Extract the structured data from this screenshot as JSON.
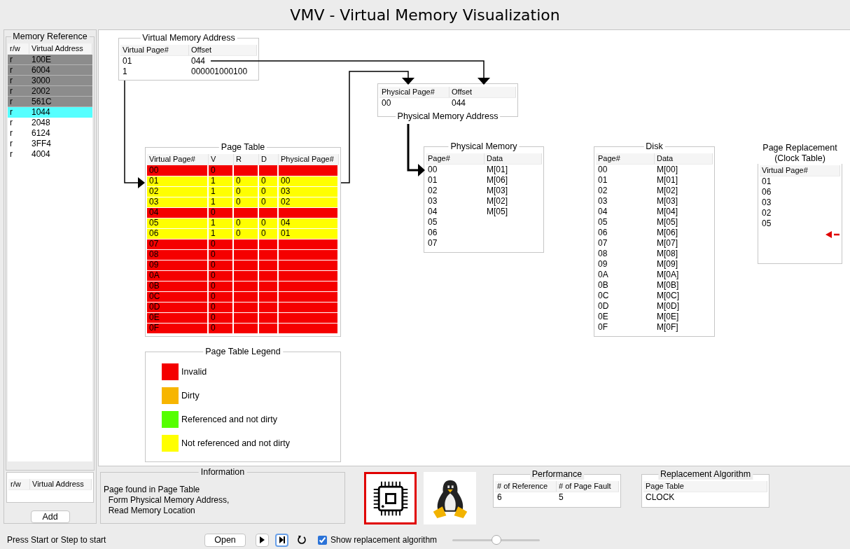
{
  "window": {
    "title": "VMV - Virtual Memory Visualization"
  },
  "memory_reference": {
    "title": "Memory Reference",
    "columns": [
      "r/w",
      "Virtual Address"
    ],
    "rows": [
      {
        "rw": "r",
        "address": "100E",
        "processed": true,
        "selected": false
      },
      {
        "rw": "r",
        "address": "6004",
        "processed": true,
        "selected": false
      },
      {
        "rw": "r",
        "address": "3000",
        "processed": true,
        "selected": false
      },
      {
        "rw": "r",
        "address": "2002",
        "processed": true,
        "selected": false
      },
      {
        "rw": "r",
        "address": "561C",
        "processed": true,
        "selected": false
      },
      {
        "rw": "r",
        "address": "1044",
        "processed": false,
        "selected": true
      },
      {
        "rw": "r",
        "address": "2048",
        "processed": false,
        "selected": false
      },
      {
        "rw": "r",
        "address": "6124",
        "processed": false,
        "selected": false
      },
      {
        "rw": "r",
        "address": "3FF4",
        "processed": false,
        "selected": false
      },
      {
        "rw": "r",
        "address": "4004",
        "processed": false,
        "selected": false
      }
    ],
    "new_reference": {
      "columns": [
        "r/w",
        "Virtual Address"
      ]
    },
    "add_button": "Add"
  },
  "virtual_address": {
    "title": "Virtual Memory Address",
    "columns": [
      "Virtual Page#",
      "Offset"
    ],
    "rows": [
      [
        "01",
        "044"
      ],
      [
        "1",
        "000001000100"
      ]
    ]
  },
  "physical_address": {
    "title": "Physical Memory Address",
    "columns": [
      "Physical Page#",
      "Offset"
    ],
    "rows": [
      [
        "00",
        "044"
      ]
    ]
  },
  "page_table": {
    "title": "Page Table",
    "columns": [
      "Virtual Page#",
      "V",
      "R",
      "D",
      "Physical Page#"
    ],
    "rows": [
      {
        "cells": [
          "00",
          "0"
        ],
        "color": "#f50000"
      },
      {
        "cells": [
          "01",
          "1",
          "0",
          "0",
          "00"
        ],
        "color": "#ffff00"
      },
      {
        "cells": [
          "02",
          "1",
          "0",
          "0",
          "03"
        ],
        "color": "#ffff00"
      },
      {
        "cells": [
          "03",
          "1",
          "0",
          "0",
          "02"
        ],
        "color": "#ffff00"
      },
      {
        "cells": [
          "04",
          "0"
        ],
        "color": "#f50000"
      },
      {
        "cells": [
          "05",
          "1",
          "0",
          "0",
          "04"
        ],
        "color": "#ffff00"
      },
      {
        "cells": [
          "06",
          "1",
          "0",
          "0",
          "01"
        ],
        "color": "#ffff00"
      },
      {
        "cells": [
          "07",
          "0"
        ],
        "color": "#f50000"
      },
      {
        "cells": [
          "08",
          "0"
        ],
        "color": "#f50000"
      },
      {
        "cells": [
          "09",
          "0"
        ],
        "color": "#f50000"
      },
      {
        "cells": [
          "0A",
          "0"
        ],
        "color": "#f50000"
      },
      {
        "cells": [
          "0B",
          "0"
        ],
        "color": "#f50000"
      },
      {
        "cells": [
          "0C",
          "0"
        ],
        "color": "#f50000"
      },
      {
        "cells": [
          "0D",
          "0"
        ],
        "color": "#f50000"
      },
      {
        "cells": [
          "0E",
          "0"
        ],
        "color": "#f50000"
      },
      {
        "cells": [
          "0F",
          "0"
        ],
        "color": "#f50000"
      }
    ]
  },
  "physical_memory": {
    "title": "Physical Memory",
    "columns": [
      "Page#",
      "Data"
    ],
    "rows": [
      [
        "00",
        "M[01]"
      ],
      [
        "01",
        "M[06]"
      ],
      [
        "02",
        "M[03]"
      ],
      [
        "03",
        "M[02]"
      ],
      [
        "04",
        "M[05]"
      ],
      [
        "05"
      ],
      [
        "06"
      ],
      [
        "07"
      ]
    ]
  },
  "disk": {
    "title": "Disk",
    "columns": [
      "Page#",
      "Data"
    ],
    "rows": [
      [
        "00",
        "M[00]"
      ],
      [
        "01",
        "M[01]"
      ],
      [
        "02",
        "M[02]"
      ],
      [
        "03",
        "M[03]"
      ],
      [
        "04",
        "M[04]"
      ],
      [
        "05",
        "M[05]"
      ],
      [
        "06",
        "M[06]"
      ],
      [
        "07",
        "M[07]"
      ],
      [
        "08",
        "M[08]"
      ],
      [
        "09",
        "M[09]"
      ],
      [
        "0A",
        "M[0A]"
      ],
      [
        "0B",
        "M[0B]"
      ],
      [
        "0C",
        "M[0C]"
      ],
      [
        "0D",
        "M[0D]"
      ],
      [
        "0E",
        "M[0E]"
      ],
      [
        "0F",
        "M[0F]"
      ]
    ]
  },
  "page_replacement": {
    "title": "Page Replacement (Clock Table)",
    "columns": [
      "Virtual Page#"
    ],
    "rows": [
      [
        "01"
      ],
      [
        "06"
      ],
      [
        "03"
      ],
      [
        "02"
      ],
      [
        "05"
      ]
    ]
  },
  "legend": {
    "title": "Page Table Legend",
    "items": [
      {
        "label": "Invalid",
        "color": "#f40000"
      },
      {
        "label": "Dirty",
        "color": "#f7b500"
      },
      {
        "label": "Referenced and not dirty",
        "color": "#55ff00"
      },
      {
        "label": "Not referenced and not dirty",
        "color": "#ffff00"
      }
    ]
  },
  "information": {
    "title": "Information",
    "text": "Page found in Page Table\n  Form Physical Memory Address,\n  Read Memory Location"
  },
  "mode_icons": [
    {
      "kind": "chip",
      "selected": true
    },
    {
      "kind": "penguin",
      "selected": false
    }
  ],
  "performance": {
    "title": "Performance",
    "columns": [
      "# of Reference",
      "# of Page Fault"
    ],
    "rows": [
      [
        "6",
        "5"
      ]
    ]
  },
  "replacement_algorithm": {
    "title": "Replacement Algorithm",
    "columns": [
      "Page Table"
    ],
    "rows": [
      [
        "CLOCK"
      ]
    ]
  },
  "status_bar": {
    "message": "Press Start or Step to start",
    "open_button": "Open",
    "show_replacement": {
      "label": "Show replacement algorithm",
      "checked": true
    },
    "speed": {
      "level": 0.5
    }
  }
}
